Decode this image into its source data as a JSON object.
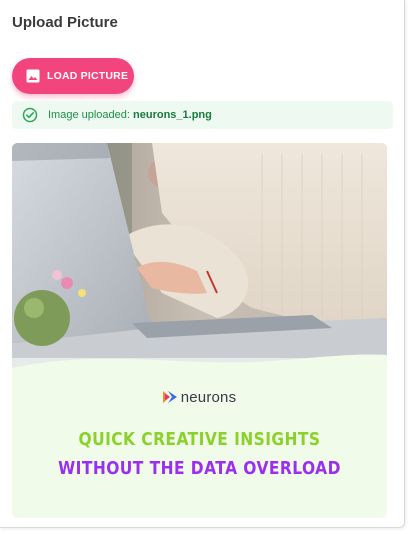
{
  "header": {
    "title": "Upload Picture"
  },
  "load_button": {
    "label": "LOAD PICTURE",
    "icon": "image-icon"
  },
  "upload_status": {
    "prefix": "Image uploaded: ",
    "filename": "neurons_1.png",
    "icon": "check-circle-icon",
    "color": "#1e8f45",
    "background": "#eefaf1"
  },
  "preview": {
    "brand": "neurons",
    "headline_line1": "QUICK CREATIVE INSIGHTS",
    "headline_line2": "WITHOUT THE DATA OVERLOAD",
    "line1_color": "#8bd12b",
    "line2_color": "#9b2ef0",
    "background": "#f1fbea"
  },
  "colors": {
    "accent": "#f3457d"
  }
}
